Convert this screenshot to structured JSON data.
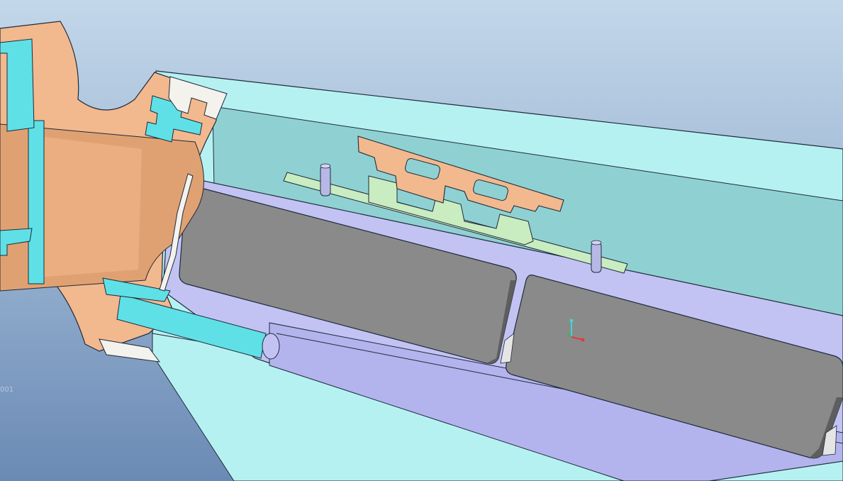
{
  "viewport": {
    "label": "001"
  },
  "colors": {
    "background_top": "#c3d7ea",
    "background_bottom": "#6a8ab5",
    "housing": "#b6f1f2",
    "housing_inner": "#8ed3d3",
    "casting": "#f2b88e",
    "casting_shadow": "#d49064",
    "tube": "#c2c3f3",
    "battery": "#8a8a8a",
    "battery_edge": "#5e5e5e",
    "pcb": "#c9ecc0",
    "pin": "#b7b8e6",
    "cyan_part": "#5fe0e6",
    "cap": "#f3f2ec",
    "edge": "#1f2a3a"
  },
  "triad": {
    "x_axis_color": "#e23b3b",
    "y_axis_color": "#3bb35a",
    "z_axis_color": "#40d4d4"
  }
}
